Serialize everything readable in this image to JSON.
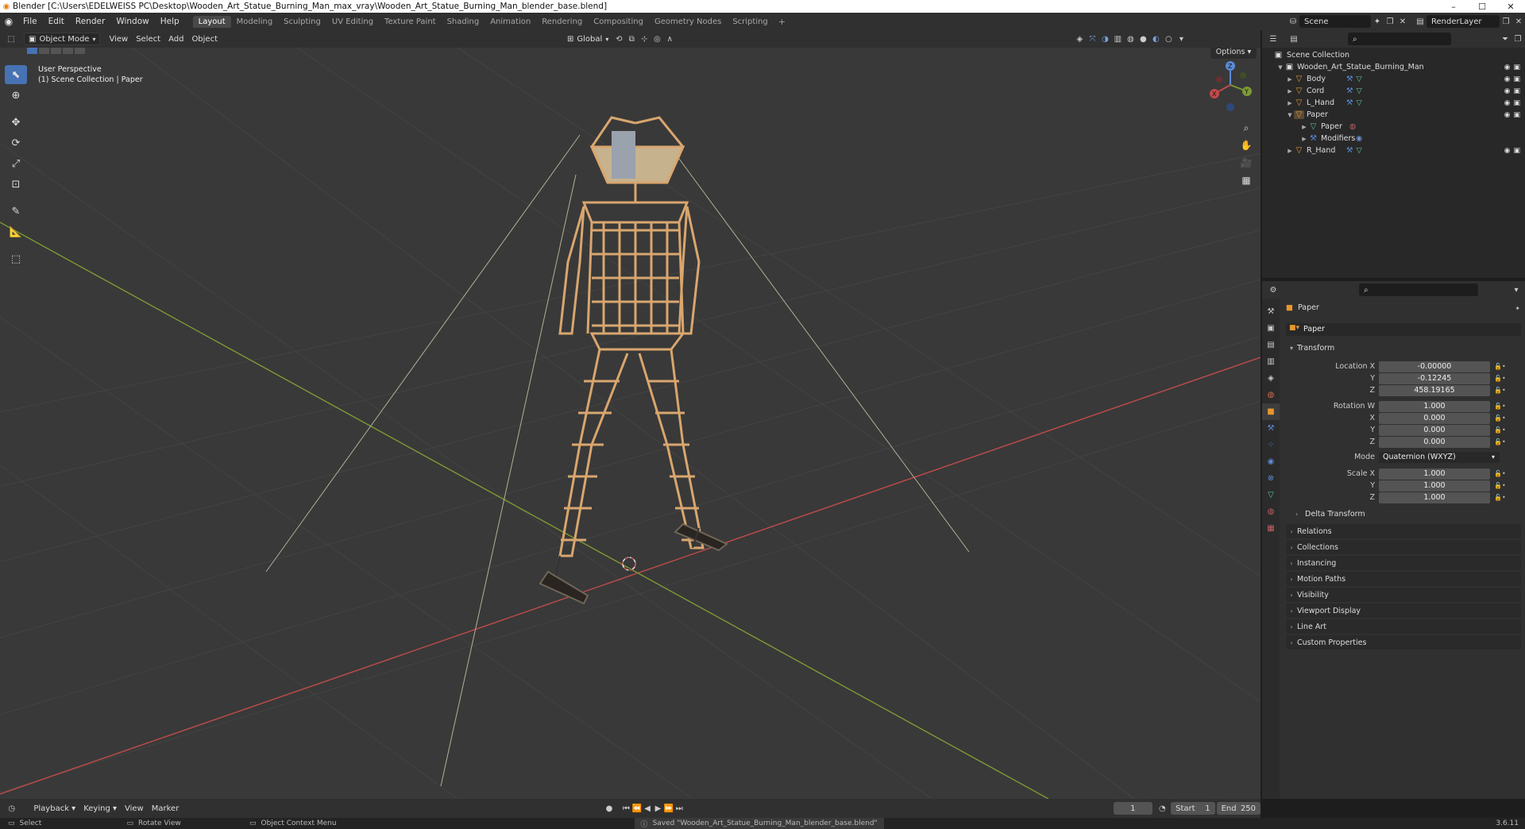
{
  "window": {
    "title": "Blender [C:\\Users\\EDELWEISS PC\\Desktop\\Wooden_Art_Statue_Burning_Man_max_vray\\Wooden_Art_Statue_Burning_Man_blender_base.blend]",
    "minimize": "–",
    "maximize": "☐",
    "close": "✕"
  },
  "menu": [
    "File",
    "Edit",
    "Render",
    "Window",
    "Help"
  ],
  "workspaces": [
    "Layout",
    "Modeling",
    "Sculpting",
    "UV Editing",
    "Texture Paint",
    "Shading",
    "Animation",
    "Rendering",
    "Compositing",
    "Geometry Nodes",
    "Scripting"
  ],
  "active_workspace": "Layout",
  "scene": {
    "name": "Scene",
    "render_layer": "RenderLayer"
  },
  "viewport_header": {
    "mode": "Object Mode",
    "menus": [
      "View",
      "Select",
      "Add",
      "Object"
    ],
    "orientation": "Global",
    "options": "Options"
  },
  "viewport": {
    "perspective": "User Perspective",
    "collection_info": "(1) Scene Collection | Paper",
    "gizmo": {
      "x": "X",
      "y": "Y",
      "z": "Z"
    }
  },
  "timeline": {
    "menus": [
      "Playback",
      "Keying",
      "View",
      "Marker"
    ],
    "current_frame": "1",
    "start_label": "Start",
    "start": "1",
    "end_label": "End",
    "end": "250"
  },
  "statusbar": {
    "select": "Select",
    "rotate": "Rotate View",
    "context": "Object Context Menu",
    "message": "Saved \"Wooden_Art_Statue_Burning_Man_blender_base.blend\"",
    "version": "3.6.11"
  },
  "outliner": {
    "root": "Scene Collection",
    "rows": [
      {
        "label": "Wooden_Art_Statue_Burning_Man",
        "level": 1
      },
      {
        "label": "Body",
        "level": 2
      },
      {
        "label": "Cord",
        "level": 2
      },
      {
        "label": "L_Hand",
        "level": 2
      },
      {
        "label": "Paper",
        "level": 2
      },
      {
        "label": "Paper",
        "level": 3
      },
      {
        "label": "Modifiers",
        "level": 3
      },
      {
        "label": "R_Hand",
        "level": 2
      }
    ]
  },
  "properties": {
    "object_name": "Paper",
    "data_name": "Paper",
    "transform_title": "Transform",
    "location": {
      "label": "Location X",
      "x": "-0.00000",
      "y": "-0.12245",
      "z": "458.19165"
    },
    "rotation": {
      "label": "Rotation W",
      "w": "1.000",
      "x": "0.000",
      "y": "0.000",
      "z": "0.000"
    },
    "mode": {
      "label": "Mode",
      "value": "Quaternion (WXYZ)"
    },
    "scale": {
      "label": "Scale X",
      "x": "1.000",
      "y": "1.000",
      "z": "1.000"
    },
    "axis_labels": {
      "x": "X",
      "y": "Y",
      "z": "Z"
    },
    "delta": "Delta Transform",
    "panels": [
      "Relations",
      "Collections",
      "Instancing",
      "Motion Paths",
      "Visibility",
      "Viewport Display",
      "Line Art",
      "Custom Properties"
    ]
  },
  "colors": {
    "accent": "#4772b3",
    "x_axis": "#c24b4b",
    "y_axis": "#7c9a35",
    "object_orange": "#e8962f",
    "mesh_green": "#58c49a",
    "wood": "#d9a66e"
  }
}
